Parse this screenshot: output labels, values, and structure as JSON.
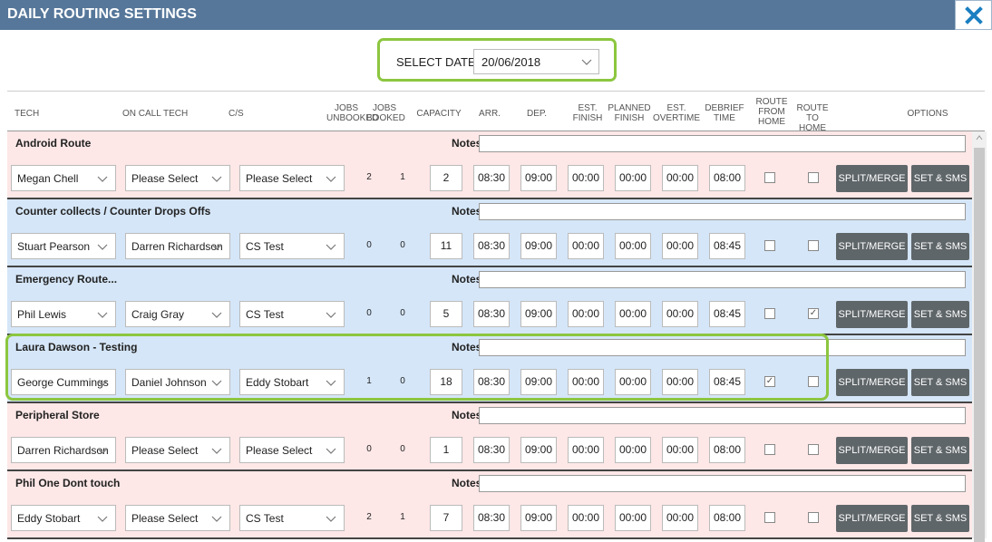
{
  "window": {
    "title": "DAILY ROUTING SETTINGS"
  },
  "date": {
    "label": "SELECT DATE:",
    "value": "20/06/2018"
  },
  "headers": {
    "tech": "TECH",
    "on_call": "ON CALL TECH",
    "cs": "C/S",
    "jobs_unbooked": "JOBS UNBOOKED",
    "jobs_booked": "JOBS BOOKED",
    "capacity": "CAPACITY",
    "arr": "ARR.",
    "dep": "DEP.",
    "est_finish": "EST. FINISH",
    "planned_finish": "PLANNED FINISH",
    "est_overtime": "EST. OVERTIME",
    "debrief": "DEBRIEF TIME",
    "route_from_home": "ROUTE FROM HOME",
    "route_to_home": "ROUTE TO HOME",
    "options": "OPTIONS"
  },
  "notes_label": "Notes:",
  "buttons": {
    "split": "SPLIT/MERGE",
    "sms": "SET & SMS"
  },
  "routes": [
    {
      "name": "Android Route",
      "color": "pink",
      "tech": "Megan Chell",
      "on_call": "Please Select",
      "cs": "Please Select",
      "unbooked": "2",
      "booked": "1",
      "capacity": "2",
      "arr": "08:30",
      "dep": "09:00",
      "est_finish": "00:00",
      "planned": "00:00",
      "overtime": "00:00",
      "debrief": "08:00",
      "from_home": false,
      "to_home": false
    },
    {
      "name": "Counter collects / Counter Drops Offs",
      "color": "blue",
      "tech": "Stuart Pearson",
      "on_call": "Darren Richardson",
      "cs": "CS Test",
      "unbooked": "0",
      "booked": "0",
      "capacity": "11",
      "arr": "08:30",
      "dep": "09:00",
      "est_finish": "00:00",
      "planned": "00:00",
      "overtime": "00:00",
      "debrief": "08:45",
      "from_home": false,
      "to_home": false
    },
    {
      "name": "Emergency Route...",
      "color": "blue",
      "tech": "Phil Lewis",
      "on_call": "Craig Gray",
      "cs": "CS Test",
      "unbooked": "0",
      "booked": "0",
      "capacity": "5",
      "arr": "08:30",
      "dep": "09:00",
      "est_finish": "00:00",
      "planned": "00:00",
      "overtime": "00:00",
      "debrief": "08:45",
      "from_home": false,
      "to_home": true
    },
    {
      "name": "Laura Dawson - Testing",
      "color": "blue",
      "tech": "George Cummings",
      "on_call": "Daniel Johnson",
      "cs": "Eddy Stobart",
      "unbooked": "1",
      "booked": "0",
      "capacity": "18",
      "arr": "08:30",
      "dep": "09:00",
      "est_finish": "00:00",
      "planned": "00:00",
      "overtime": "00:00",
      "debrief": "08:45",
      "from_home": true,
      "to_home": false
    },
    {
      "name": "Peripheral Store",
      "color": "pink",
      "tech": "Darren Richardson",
      "on_call": "Please Select",
      "cs": "Please Select",
      "unbooked": "0",
      "booked": "0",
      "capacity": "1",
      "arr": "08:30",
      "dep": "09:00",
      "est_finish": "00:00",
      "planned": "00:00",
      "overtime": "00:00",
      "debrief": "08:00",
      "from_home": false,
      "to_home": false
    },
    {
      "name": "Phil One Dont touch",
      "color": "pink",
      "tech": "Eddy Stobart",
      "on_call": "Please Select",
      "cs": "CS Test",
      "unbooked": "2",
      "booked": "1",
      "capacity": "7",
      "arr": "08:30",
      "dep": "09:00",
      "est_finish": "00:00",
      "planned": "00:00",
      "overtime": "00:00",
      "debrief": "08:00",
      "from_home": false,
      "to_home": false
    }
  ]
}
